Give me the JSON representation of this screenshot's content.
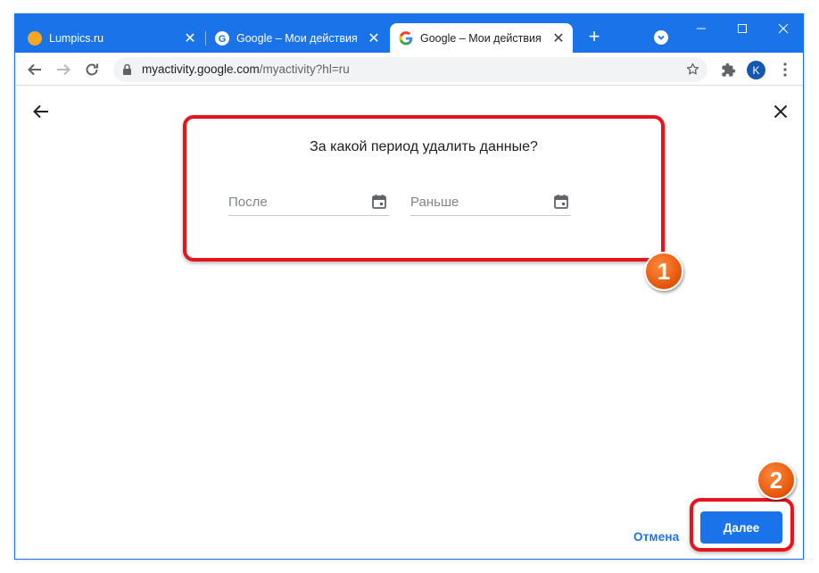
{
  "browser": {
    "tabs": [
      {
        "title": "Lumpics.ru",
        "active": false
      },
      {
        "title": "Google – Мои действия",
        "active": false
      },
      {
        "title": "Google – Мои действия",
        "active": true
      }
    ],
    "url_host": "myactivity.google.com",
    "url_path": "/myactivity?hl=ru",
    "profile_initial": "K",
    "accent_color": "#1a73e8"
  },
  "dialog": {
    "title": "За какой период удалить данные?",
    "after_placeholder": "После",
    "before_placeholder": "Раньше",
    "cancel_label": "Отмена",
    "next_label": "Далее"
  },
  "annotations": {
    "badge_1": "1",
    "badge_2": "2",
    "highlight_color": "#e8141c"
  }
}
